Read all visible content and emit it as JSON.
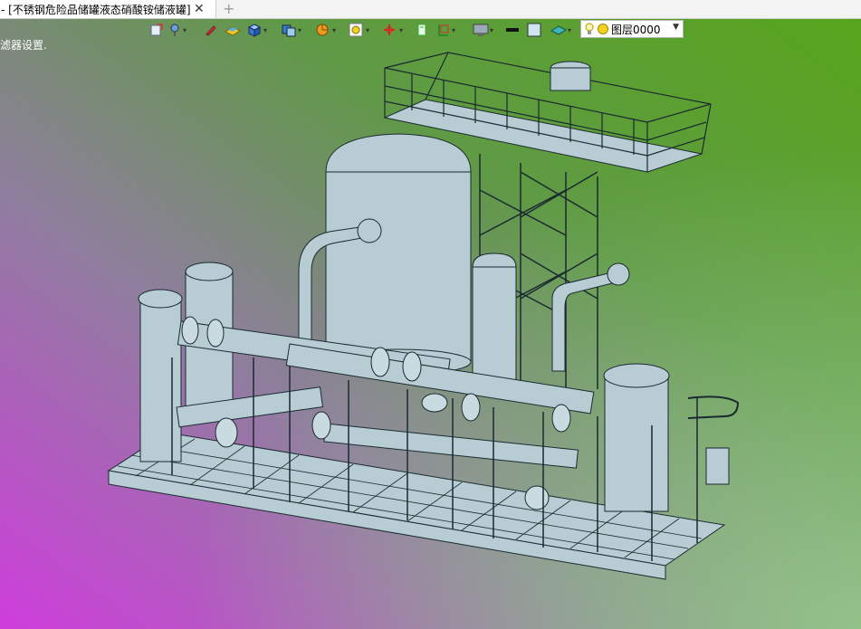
{
  "tab": {
    "title": "- [不锈钢危险品储罐液态硝酸铵储液罐]",
    "close_glyph": "✕",
    "add_glyph": "+"
  },
  "hint_text": "滤器设置.",
  "toolbar": {
    "layer": {
      "name": "图层0000",
      "dropdown_glyph": "▼"
    },
    "icons": [
      "insert-icon",
      "pin-icon",
      "brush-icon",
      "surface-icon",
      "cube-icon",
      "view-cube-icon",
      "pie-icon",
      "zoom-icon",
      "axis-icon",
      "ruler-icon",
      "frame-icon",
      "monitor-icon",
      "line-weight-icon",
      "color-swatch-icon",
      "fill-icon",
      "bulb-icon",
      "sun-icon"
    ]
  },
  "colors": {
    "equipment": "#b8ccd3",
    "outline": "#1a2a30",
    "accent_layer_sun": "#f4d21a"
  }
}
